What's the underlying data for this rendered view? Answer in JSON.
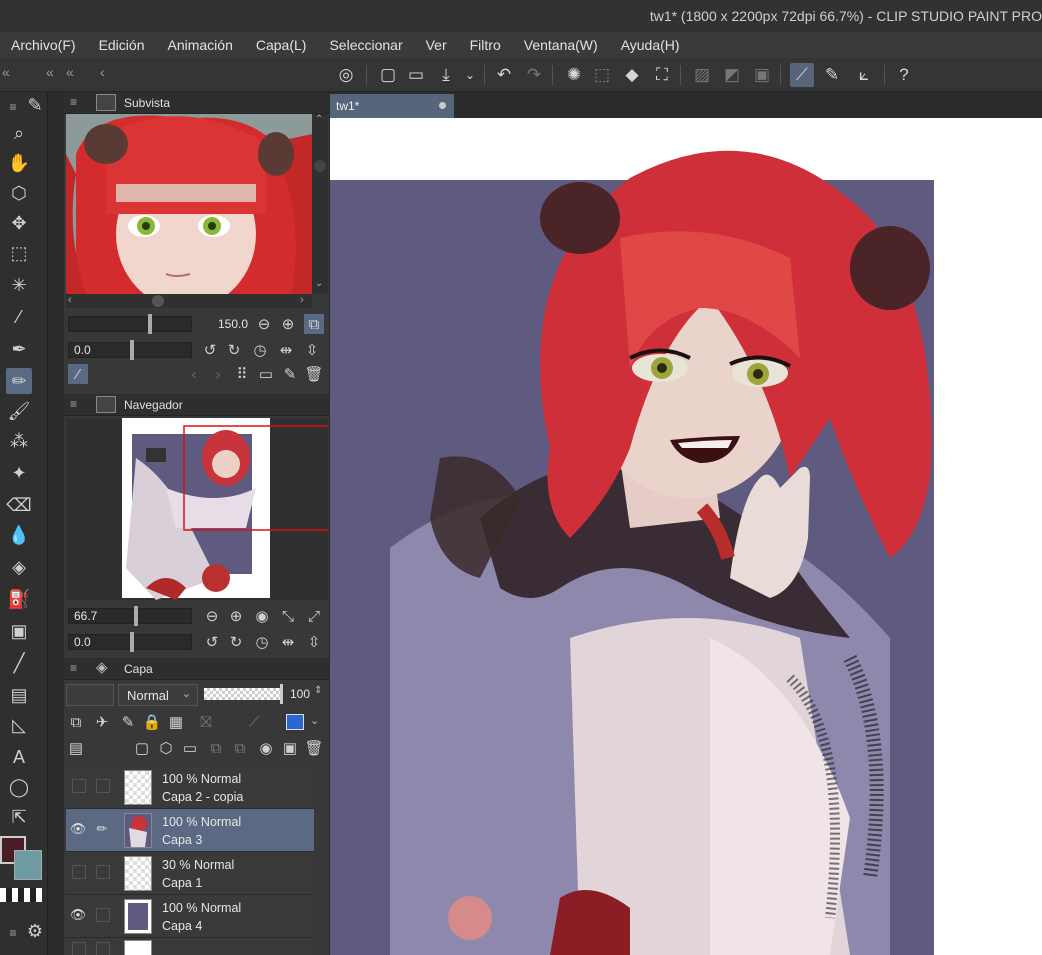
{
  "window": {
    "title": "tw1* (1800 x 2200px 72dpi 66.7%)  - CLIP STUDIO PAINT PRO"
  },
  "menu": [
    "Archivo(F)",
    "Edición",
    "Animación",
    "Capa(L)",
    "Seleccionar",
    "Ver",
    "Filtro",
    "Ventana(W)",
    "Ayuda(H)"
  ],
  "subvista": {
    "title": "Subvista",
    "zoom": "150.0",
    "angle": "0.0"
  },
  "navegador": {
    "title": "Navegador",
    "zoom": "66.7",
    "angle": "0.0"
  },
  "capa": {
    "title": "Capa",
    "blend_mode": "Normal",
    "opacity": "100",
    "layers": [
      {
        "line1": "100 % Normal",
        "line2": "Capa 2 - copia",
        "visible": false,
        "selected": false
      },
      {
        "line1": "100 % Normal",
        "line2": "Capa 3",
        "visible": true,
        "selected": true
      },
      {
        "line1": "30 % Normal",
        "line2": "Capa 1",
        "visible": false,
        "selected": false
      },
      {
        "line1": "100 % Normal",
        "line2": "Capa 4",
        "visible": true,
        "selected": false
      }
    ]
  },
  "document": {
    "tab_label": "tw1*"
  },
  "colors": {
    "accent": "#56657a",
    "main_color": "#4a1d26",
    "sub_color": "#6e9aa2",
    "canvas_bg": "#5f5a80"
  }
}
